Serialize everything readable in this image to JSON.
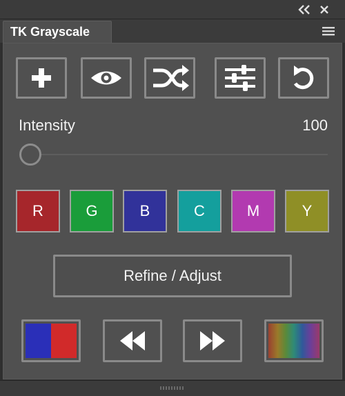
{
  "window": {
    "tab_title": "TK Grayscale"
  },
  "toolbar": {
    "buttons": [
      {
        "id": "add",
        "icon": "plus-icon"
      },
      {
        "id": "preview",
        "icon": "eye-icon"
      },
      {
        "id": "randomize",
        "icon": "shuffle-icon"
      },
      {
        "id": "settings",
        "icon": "sliders-icon"
      },
      {
        "id": "reset",
        "icon": "undo-icon"
      }
    ]
  },
  "intensity": {
    "label": "Intensity",
    "value": "100",
    "slider_fraction": 0
  },
  "color_channels": [
    {
      "label": "R",
      "color": "#a6262b"
    },
    {
      "label": "G",
      "color": "#1a9d3a"
    },
    {
      "label": "B",
      "color": "#31329a"
    },
    {
      "label": "C",
      "color": "#149f9d"
    },
    {
      "label": "M",
      "color": "#b23ab0"
    },
    {
      "label": "Y",
      "color": "#8f8f26"
    }
  ],
  "refine": {
    "label": "Refine / Adjust"
  },
  "bottom_bar": {
    "swatch_colors": [
      "#2a2fb8",
      "#d12a2a"
    ],
    "rewind_icon": "rewind-icon",
    "forward_icon": "fast-forward-icon",
    "spectrum_icon": "spectrum-icon"
  },
  "colors": {
    "panel_bg": "#505050",
    "chrome_bg": "#3b3b3b",
    "button_border": "#8a8a8a"
  }
}
